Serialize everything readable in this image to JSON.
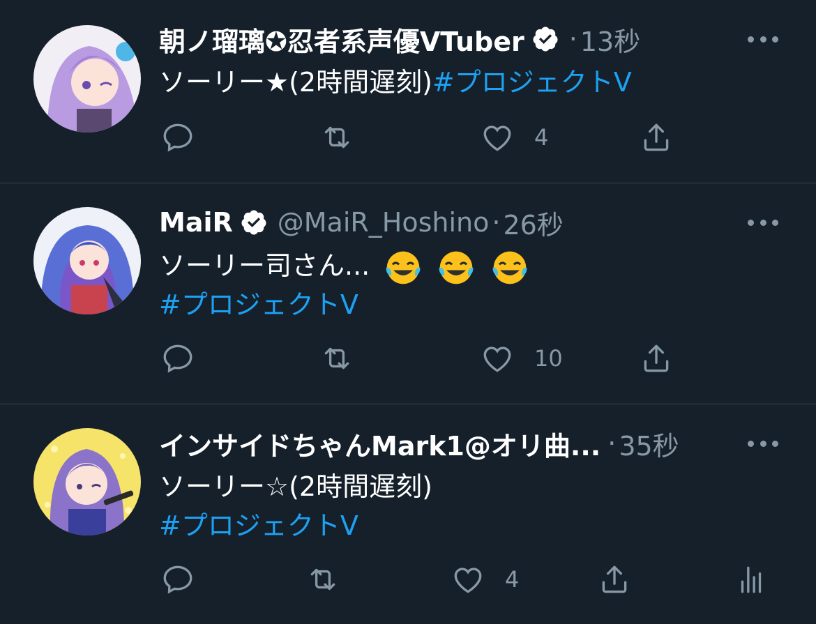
{
  "tweets": [
    {
      "name": "朝ノ瑠璃✪忍者系声優VTuber",
      "handle": "",
      "separator": "·",
      "time": "13秒",
      "text": "ソーリー★(2時間遅刻)",
      "hashtag": "#プロジェクトV",
      "likes": "4",
      "avatar_bg": "#f2eef6",
      "avatar_accent": "#b89be0"
    },
    {
      "name": "MaiR",
      "handle": "@MaiR_Hoshino",
      "separator": "·",
      "time": "26秒",
      "text": "ソーリー司さん...",
      "hashtag": "#プロジェクトV",
      "likes": "10",
      "avatar_bg": "#eef1f7",
      "avatar_accent": "#5a6fd6"
    },
    {
      "name": "インサイドちゃんMark1@オリ曲...",
      "handle": "",
      "separator": "·",
      "time": "35秒",
      "text": "ソーリー☆(2時間遅刻)",
      "hashtag": "#プロジェクトV",
      "likes": "4",
      "avatar_bg": "#f6e36a",
      "avatar_accent": "#8a73c9"
    }
  ],
  "colors": {
    "background": "#15202b",
    "divider": "#38444d",
    "muted": "#8899a6",
    "link": "#1da1f2"
  },
  "icons": [
    "reply-icon",
    "retweet-icon",
    "like-icon",
    "share-icon",
    "analytics-icon",
    "verified-icon",
    "more-icon"
  ]
}
